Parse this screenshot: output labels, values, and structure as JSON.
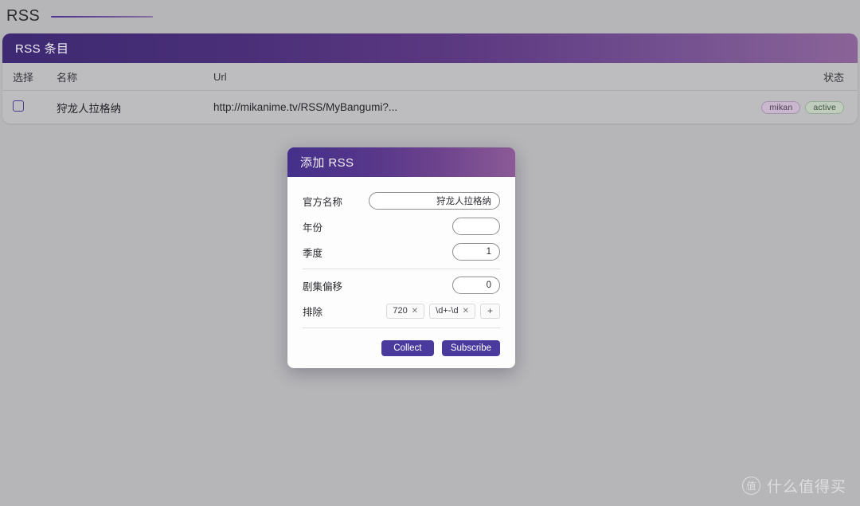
{
  "page": {
    "title": "RSS"
  },
  "panel": {
    "header_title": "RSS 条目",
    "columns": {
      "select": "选择",
      "name": "名称",
      "url": "Url",
      "status": "状态"
    },
    "rows": [
      {
        "checked": false,
        "name": "狩龙人拉格纳",
        "url": "http://mikanime.tv/RSS/MyBangumi?...",
        "badges": [
          {
            "label": "mikan",
            "kind": "source"
          },
          {
            "label": "active",
            "kind": "state"
          }
        ]
      }
    ]
  },
  "modal": {
    "title": "添加 RSS",
    "fields": {
      "official_name": {
        "label": "官方名称",
        "value": "狩龙人拉格纳",
        "placeholder": ""
      },
      "year": {
        "label": "年份",
        "value": "",
        "placeholder": ""
      },
      "season": {
        "label": "季度",
        "value": "1",
        "placeholder": ""
      },
      "episode_offset": {
        "label": "剧集偏移",
        "value": "0",
        "placeholder": ""
      },
      "exclude": {
        "label": "排除",
        "tags": [
          "720",
          "\\d+-\\d"
        ],
        "remove_glyph": "✕",
        "add_label": "+"
      }
    },
    "buttons": {
      "collect": "Collect",
      "subscribe": "Subscribe"
    }
  },
  "watermark": {
    "logo_char": "值",
    "text": "什么值得买"
  },
  "colors": {
    "page_background": "#b6b6b9",
    "panel_gradient_start": "#3d2a72",
    "panel_gradient_end": "#8a6498",
    "accent_button": "#4a3a9e",
    "checkbox_border": "#4b3a8f",
    "badge_mikan_bg": "#c9b7cd",
    "badge_active_bg": "#c0cdbe"
  }
}
